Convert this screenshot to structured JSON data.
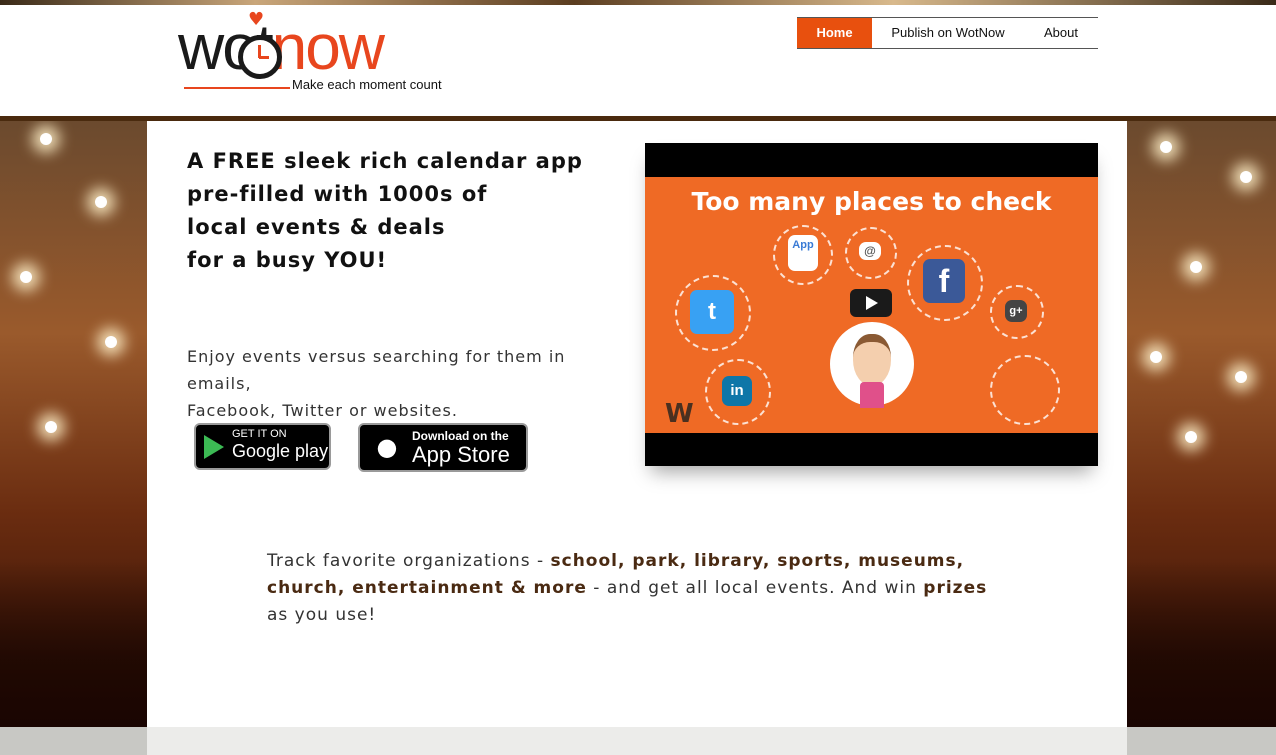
{
  "brand": {
    "logo_text_dark": "wot",
    "logo_text_accent": "now",
    "tagline": "Make each moment count",
    "accent_color": "#e8461e"
  },
  "nav": {
    "items": [
      {
        "label": "Home",
        "active": true
      },
      {
        "label": "Publish on WotNow",
        "active": false
      },
      {
        "label": "About",
        "active": false
      }
    ],
    "active_color": "#e8500e"
  },
  "hero": {
    "headline": "A FREE sleek rich calendar app\npre-filled with 1000s of\nlocal events & deals\nfor a busy YOU!",
    "subtext": "Enjoy events versus searching for them in emails,\nFacebook, Twitter or websites."
  },
  "badges": {
    "google_play": {
      "small": "GET IT ON",
      "big": "Google play"
    },
    "app_store": {
      "small": "Download on the",
      "big": "App Store"
    }
  },
  "video": {
    "title": "Too many places to check",
    "icons": {
      "app": "App",
      "email": "@",
      "facebook": "f",
      "twitter": "t",
      "gplus": "g+",
      "linkedin": "in"
    },
    "watermark": "W"
  },
  "track": {
    "part1": "Track favorite organizations - ",
    "bold1": "school, park, library, sports, museums, church, entertainment & more",
    "part2": " - and get all local events. And win ",
    "bold2": "prizes",
    "part3": " as you use!"
  }
}
